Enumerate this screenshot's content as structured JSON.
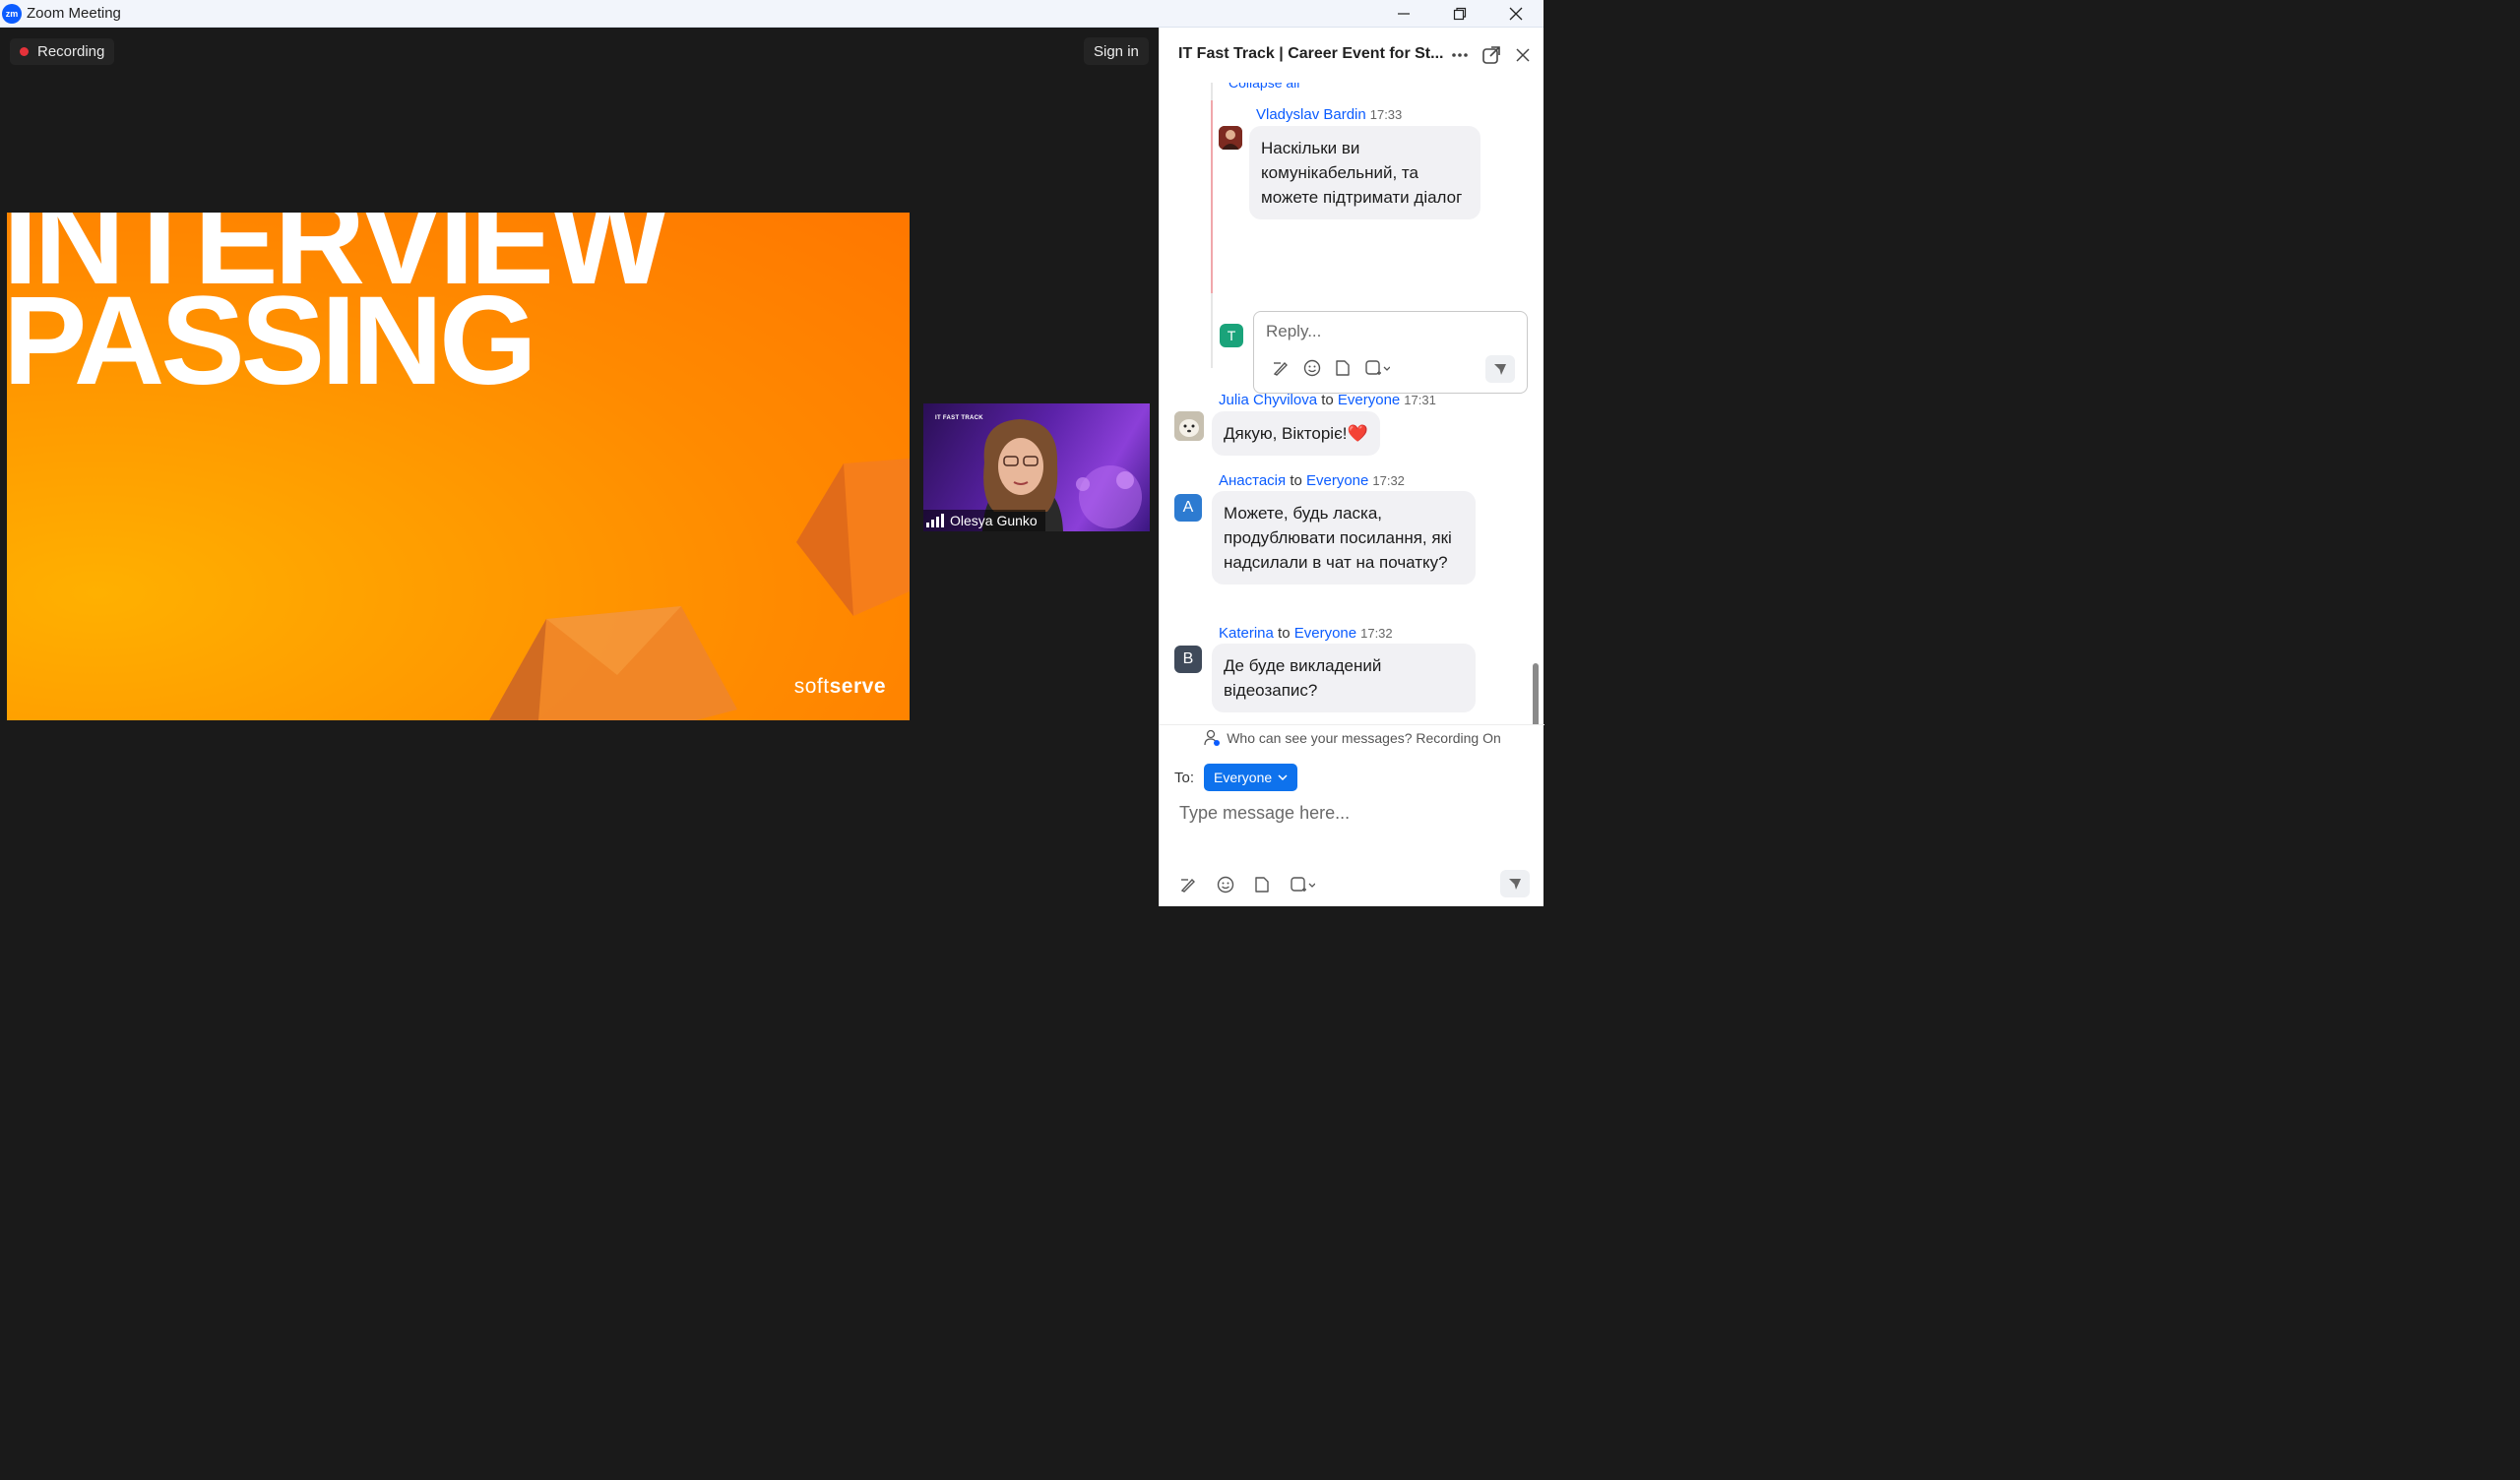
{
  "window": {
    "logo_text": "zm",
    "title": "Zoom Meeting"
  },
  "meeting": {
    "recording_label": "Recording",
    "signin_label": "Sign in",
    "slide": {
      "line1": "INTERVIEW",
      "line2": "PASSING",
      "brand_prefix": "soft",
      "brand_suffix": "serve"
    },
    "participant": {
      "name": "Olesya Gunko",
      "background_tag": "IT FAST TRACK"
    }
  },
  "chat": {
    "title": "IT Fast Track | Career Event for St...",
    "collapse_text": "Collapse all",
    "messages": [
      {
        "sender": "Vladyslav Bardin",
        "recipient": "",
        "time": "17:33",
        "text": "Наскільки  ви комунікабельний, та можете підтримати діалог",
        "avatar": ""
      },
      {
        "sender": "Julia Chyvilova",
        "recipient": "Everyone",
        "time": "17:31",
        "text": "Дякую, Вікторіє!❤️",
        "avatar": ""
      },
      {
        "sender": "Анастасія",
        "recipient": "Everyone",
        "time": "17:32",
        "text": "Можете, будь ласка, продублювати посилання, які надсилали в чат на початку?",
        "avatar": "A"
      },
      {
        "sender": "Katerina",
        "recipient": "Everyone",
        "time": "17:32",
        "text": "Де буде викладений відеозапис?",
        "avatar": "B"
      }
    ],
    "to_word": "to",
    "reply": {
      "avatar": "T",
      "placeholder": "Reply..."
    },
    "privacy_text": "Who can see your messages? Recording On",
    "to_label": "To:",
    "to_value": "Everyone",
    "compose_placeholder": "Type message here...",
    "colors": {
      "accent": "#0b5cff",
      "to_button": "#0e72ed",
      "avatar_a": "#2d7bd1",
      "avatar_b": "#3f4a5a",
      "avatar_t": "#1aa37a"
    }
  }
}
